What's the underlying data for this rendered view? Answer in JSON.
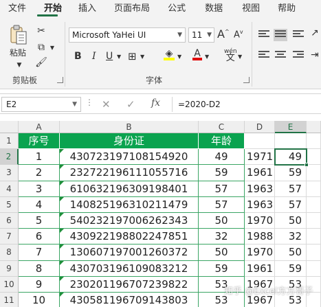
{
  "ribbon_tabs": [
    "文件",
    "开始",
    "插入",
    "页面布局",
    "公式",
    "数据",
    "视图",
    "帮助"
  ],
  "active_tab": "开始",
  "clipboard": {
    "paste_label": "粘贴",
    "group_label": "剪贴板"
  },
  "font_group": {
    "font_name": "Microsoft YaHei UI",
    "font_size": "11",
    "group_label": "字体",
    "wen_label": "wén"
  },
  "formula_bar": {
    "name_box": "E2",
    "fx_label": "fx",
    "formula": "=2020-D2"
  },
  "columns": [
    "A",
    "B",
    "C",
    "D",
    "E"
  ],
  "selected_column": "E",
  "rows": [
    "1",
    "2",
    "3",
    "4",
    "5",
    "6",
    "7",
    "8",
    "9",
    "10",
    "11"
  ],
  "selected_row": "2",
  "table": {
    "headers": [
      "序号",
      "身份证",
      "年龄"
    ],
    "records": [
      {
        "no": "1",
        "id": "430723197108154920",
        "age": "49",
        "year": "1971",
        "calc": "49"
      },
      {
        "no": "2",
        "id": "232722196111055716",
        "age": "59",
        "year": "1961",
        "calc": "59"
      },
      {
        "no": "3",
        "id": "610632196309198401",
        "age": "57",
        "year": "1963",
        "calc": "57"
      },
      {
        "no": "4",
        "id": "140825196310211479",
        "age": "57",
        "year": "1963",
        "calc": "57"
      },
      {
        "no": "5",
        "id": "540232197006262343",
        "age": "50",
        "year": "1970",
        "calc": "50"
      },
      {
        "no": "6",
        "id": "430922198802247851",
        "age": "32",
        "year": "1988",
        "calc": "32"
      },
      {
        "no": "7",
        "id": "130607197001260372",
        "age": "50",
        "year": "1970",
        "calc": "50"
      },
      {
        "no": "8",
        "id": "430703196109083212",
        "age": "59",
        "year": "1961",
        "calc": "59"
      },
      {
        "no": "9",
        "id": "230201196707239822",
        "age": "53",
        "year": "1967",
        "calc": "53"
      },
      {
        "no": "10",
        "id": "430581196709143803",
        "age": "53",
        "year": "1967",
        "calc": "53"
      }
    ]
  },
  "watermark": "知乎 @Excel方方哥子",
  "colors": {
    "accent": "#217346",
    "header_fill": "#0aa34f"
  }
}
